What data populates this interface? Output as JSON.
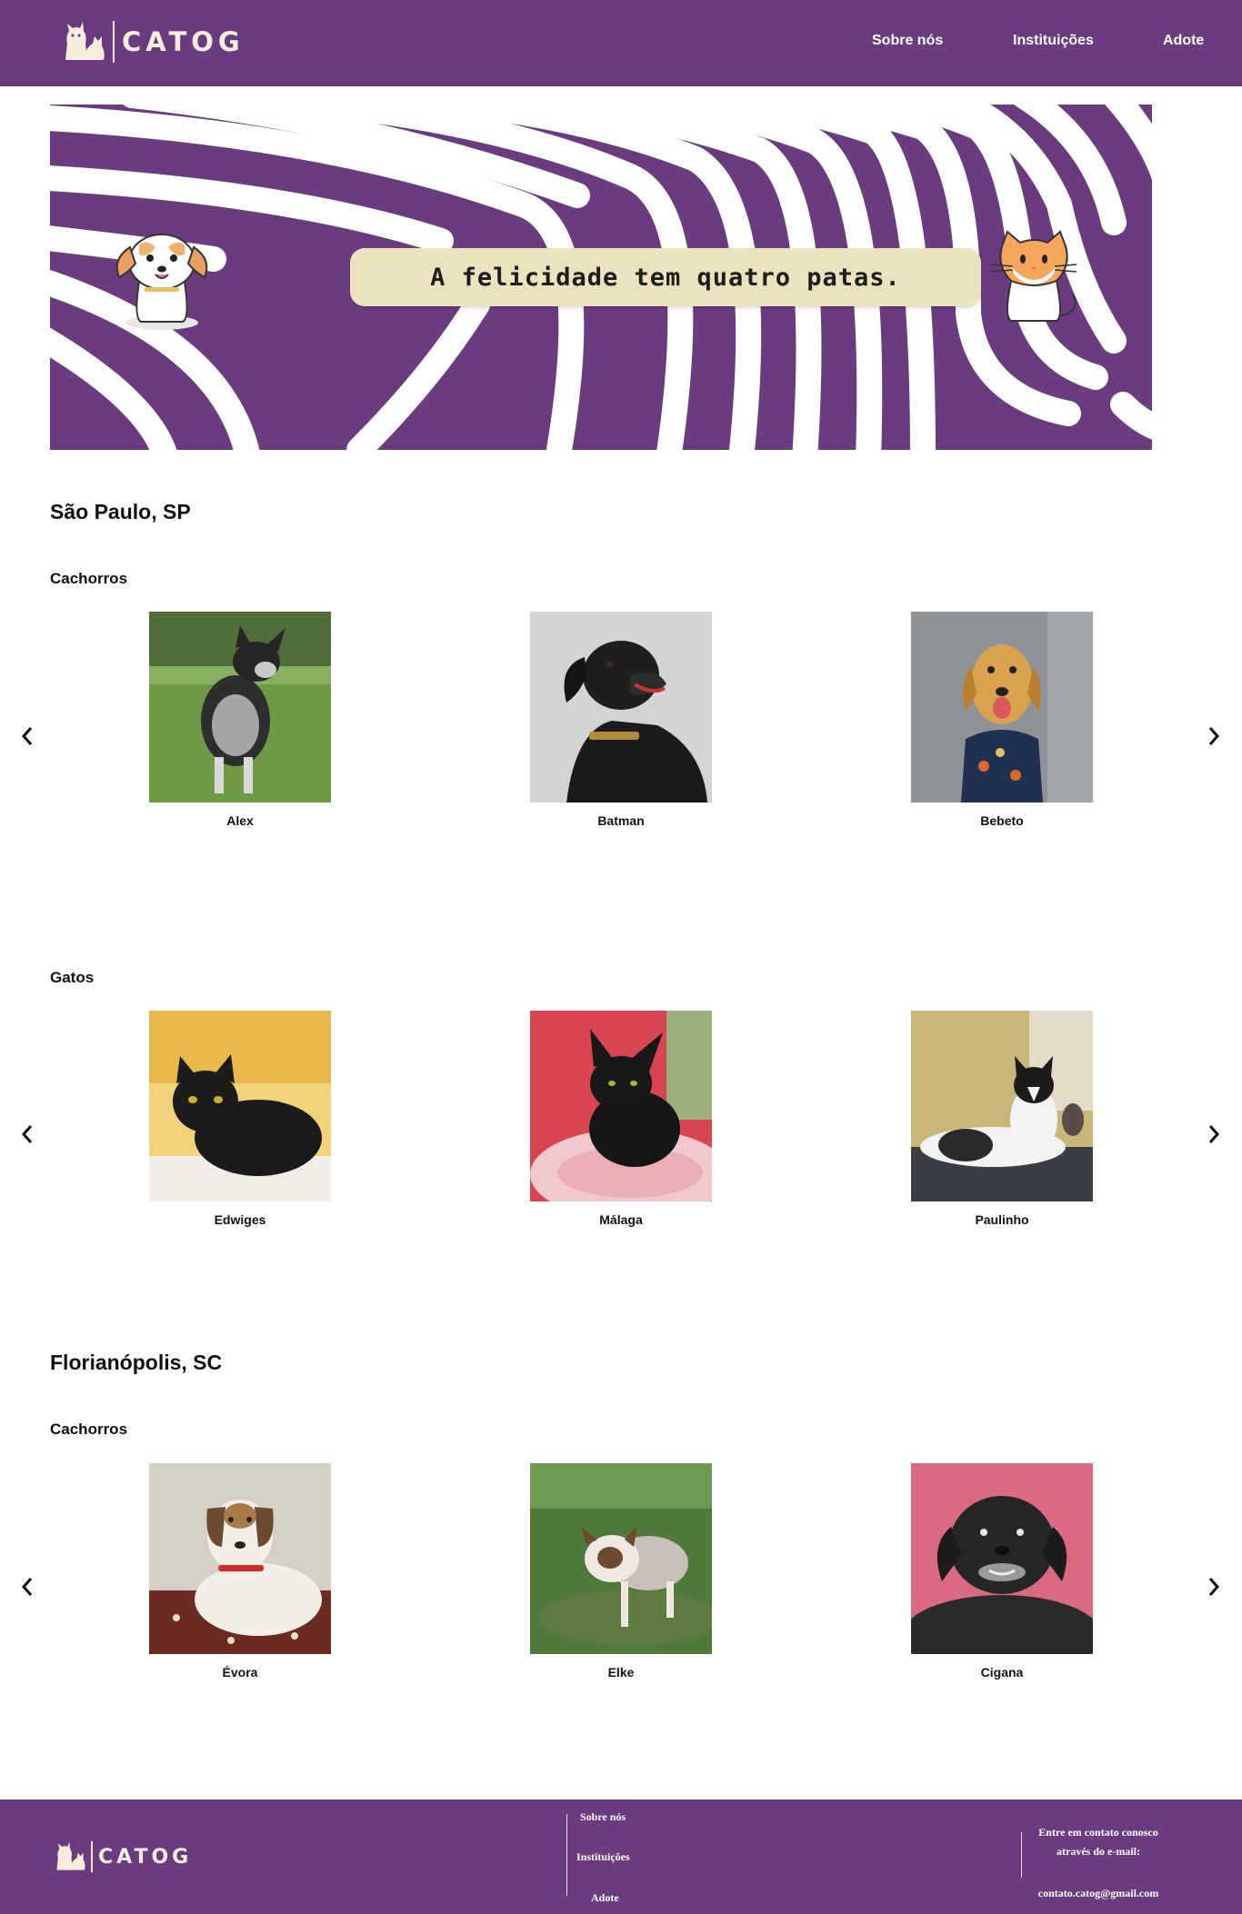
{
  "header": {
    "logo_text": "CATOG",
    "nav": [
      "Sobre nós",
      "Instituições",
      "Adote"
    ]
  },
  "banner": {
    "slogan": "A felicidade tem quatro patas.",
    "left_art": "cartoon-dog",
    "right_art": "cartoon-cat"
  },
  "sections": [
    {
      "city": "São Paulo, SP",
      "groups": [
        {
          "category": "Cachorros",
          "pets": [
            "Alex",
            "Batman",
            "Bebeto"
          ]
        },
        {
          "category": "Gatos",
          "pets": [
            "Edwiges",
            "Málaga",
            "Paulinho"
          ]
        }
      ]
    },
    {
      "city": "Florianópolis, SC",
      "groups": [
        {
          "category": "Cachorros",
          "pets": [
            "Évora",
            "Elke",
            "Cigana"
          ]
        }
      ]
    }
  ],
  "icons": {
    "prev": "chevron-left-icon",
    "next": "chevron-right-icon",
    "logo": "dog-cat-logo-icon"
  },
  "footer": {
    "logo_text": "CATOG",
    "links": [
      "Sobre nós",
      "Instituições",
      "Adote"
    ],
    "contact_text": "Entre em contato conosco através do e-mail:",
    "email": "contato.catog@gmail.com"
  },
  "colors": {
    "brand_purple": "#6b3b7f",
    "logo_cream": "#f7efdc",
    "slogan_bg": "#ebe3bd"
  }
}
